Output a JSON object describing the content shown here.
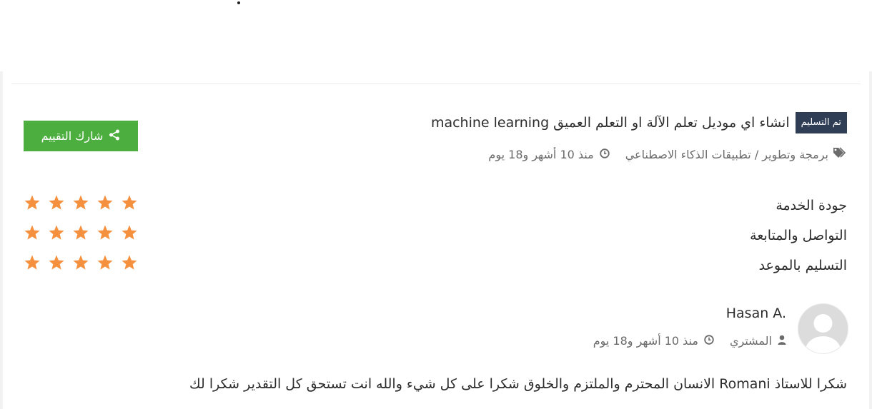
{
  "project": {
    "status_badge": "تم التسليم",
    "title": "انشاء اي موديل تعلم الآلة او التعلم العميق machine learning",
    "category": "برمجة وتطوير / تطبيقات الذكاء الاصطناعي",
    "time_ago": "منذ 10 أشهر و18 يوم"
  },
  "share_button": {
    "label": "شارك التقييم"
  },
  "ratings": [
    {
      "label": "جودة الخدمة",
      "stars": 5,
      "max": 5
    },
    {
      "label": "التواصل والمتابعة",
      "stars": 5,
      "max": 5
    },
    {
      "label": "التسليم بالموعد",
      "stars": 5,
      "max": 5
    }
  ],
  "reviewer": {
    "name": "Hasan A.",
    "role": "المشتري",
    "time_ago": "منذ 10 أشهر و18 يوم"
  },
  "comment": "شكرا للاستاذ Romani الانسان المحترم والملتزم والخلوق شكرا على كل شيء والله انت تستحق كل التقدير شكرا لك",
  "colors": {
    "badge_bg": "#2f3d55",
    "share_button_bg": "#4cae3f",
    "star": "#f5913e",
    "meta_text": "#6b6b6b"
  },
  "icons": {
    "category": "tags-icon",
    "time": "clock-icon",
    "role": "user-icon",
    "share": "share-icon",
    "rating": "star-icon",
    "avatar": "default-avatar-icon"
  }
}
